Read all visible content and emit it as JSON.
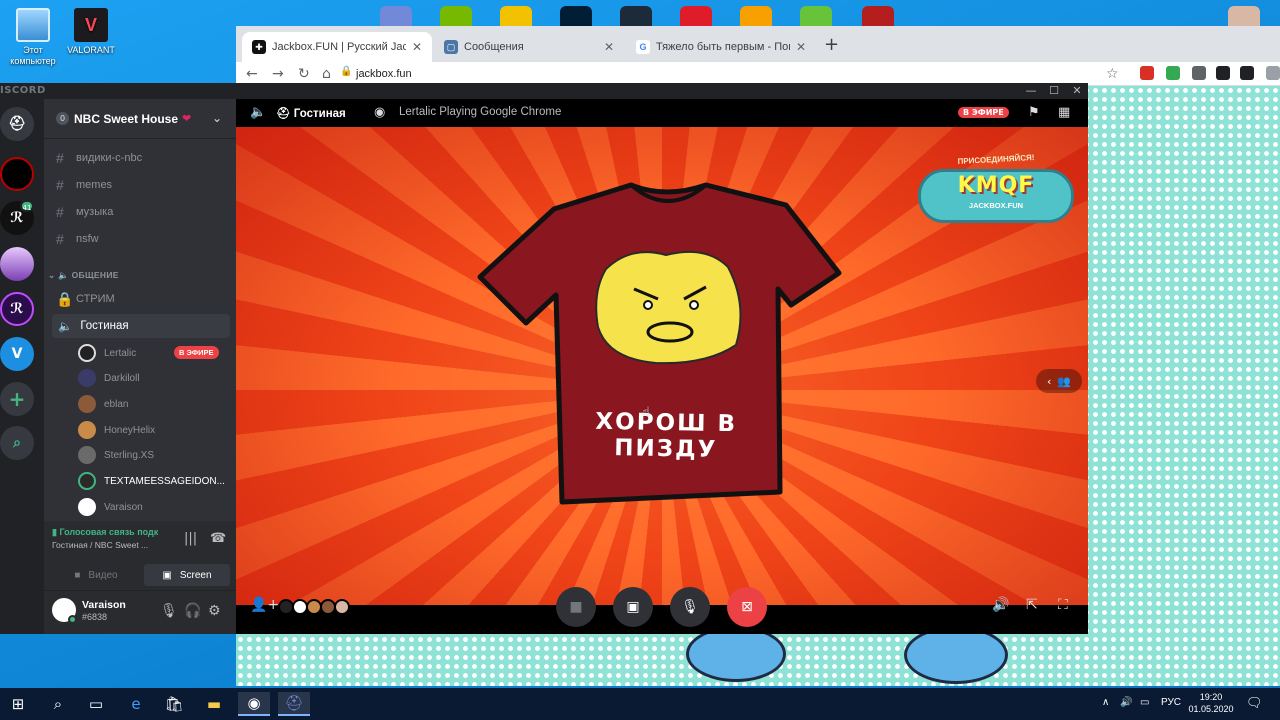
{
  "desktop": {
    "icons": [
      {
        "label": "Этот компьютер"
      },
      {
        "label": "VALORANT"
      }
    ]
  },
  "browser": {
    "tabs": [
      {
        "title": "Jackbox.FUN | Русский Jackbox",
        "active": true
      },
      {
        "title": "Сообщения",
        "active": false
      },
      {
        "title": "Тяжело быть первым - Поиск в",
        "active": false
      }
    ],
    "url": "jackbox.fun"
  },
  "discord": {
    "brand": "ISCORD",
    "server": {
      "name": "NBC Sweet House",
      "boost": "0"
    },
    "guild_badge": "41",
    "text_channels": [
      "видики-с-nbc",
      "memes",
      "музыка",
      "nsfw"
    ],
    "voice_category": "ОБЩЕНИЕ",
    "locked_channel": "СТРИМ",
    "voice_channel": "Гостиная",
    "voice_users": [
      {
        "name": "Lertalic",
        "live": "В ЭФИРЕ"
      },
      {
        "name": "Darkiloll"
      },
      {
        "name": "eblan"
      },
      {
        "name": "HoneyHelix"
      },
      {
        "name": "Sterling.XS"
      },
      {
        "name": "TEXTAMEESSAGEIDON..."
      },
      {
        "name": "Varaison"
      }
    ],
    "voice_panel": {
      "status": "Голосовая связь подк",
      "sub": "Гостиная / NBC Sweet ...",
      "video_label": "Видео",
      "screen_label": "Screen"
    },
    "user": {
      "name": "Varaison",
      "tag": "#6838"
    },
    "stream": {
      "channel": "Гостиная",
      "title": "Lertalic Playing Google Chrome",
      "live": "В ЭФИРЕ"
    },
    "game": {
      "logo_top": "ПРИСОЕДИНЯЙСЯ!",
      "logo_main": "KMQF",
      "logo_sub": "JACKBOX.FUN",
      "shirt_caption": "ХОРОШ В ПИЗДУ"
    }
  },
  "taskbar": {
    "lang": "РУС",
    "time": "19:20",
    "date": "01.05.2020"
  }
}
